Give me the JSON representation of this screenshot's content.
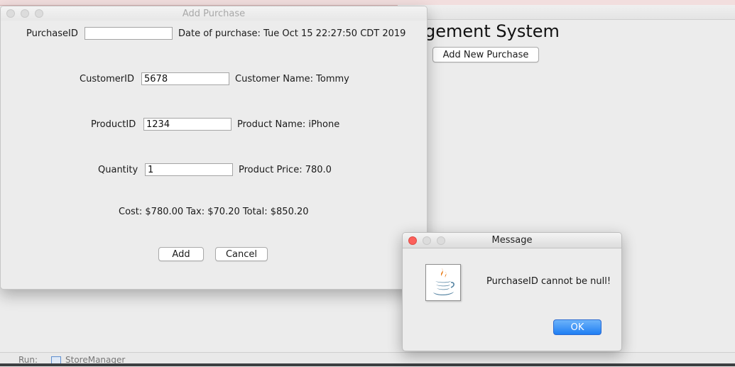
{
  "main_window": {
    "title_fragment": "gement System",
    "add_button_label": "Add New Purchase"
  },
  "ide": {
    "run_label": "Run:",
    "tab_label": "StoreManager"
  },
  "purchase_window": {
    "title": "Add Purchase",
    "purchase_id_label": "PurchaseID",
    "purchase_id_value": "",
    "date_label": "Date of purchase: Tue Oct 15 22:27:50 CDT 2019",
    "customer_id_label": "CustomerID",
    "customer_id_value": "5678",
    "customer_name_label": "Customer Name: Tommy",
    "product_id_label": "ProductID",
    "product_id_value": "1234",
    "product_name_label": "Product Name: iPhone",
    "quantity_label": "Quantity",
    "quantity_value": "1",
    "product_price_label": "Product Price: 780.0",
    "cost_summary": "Cost: $780.00 Tax: $70.20 Total: $850.20",
    "add_button": "Add",
    "cancel_button": "Cancel"
  },
  "message_dialog": {
    "title": "Message",
    "text": "PurchaseID cannot be null!",
    "ok_button": "OK",
    "icon": "java-icon"
  },
  "colors": {
    "ok_button": "#1f7ef3",
    "close_button": "#fc605b",
    "window_bg": "#ececec"
  }
}
